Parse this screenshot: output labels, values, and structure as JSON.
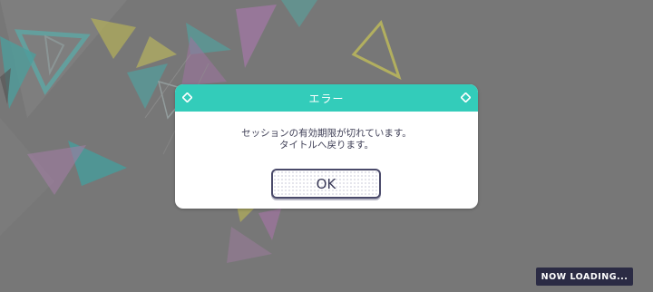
{
  "dialog": {
    "title": "エラー",
    "message_line1": "セッションの有効期限が切れています。",
    "message_line2": "タイトルへ戻ります。",
    "ok_label": "OK"
  },
  "status": {
    "loading_text": "NOW LOADING..."
  },
  "colors": {
    "header": "#33ccba",
    "button_border": "#4a4a6a",
    "loading_badge": "#2b2b44",
    "background": "#7b7b7b"
  },
  "icons": {
    "dialog_corners": "diamond-icon"
  }
}
